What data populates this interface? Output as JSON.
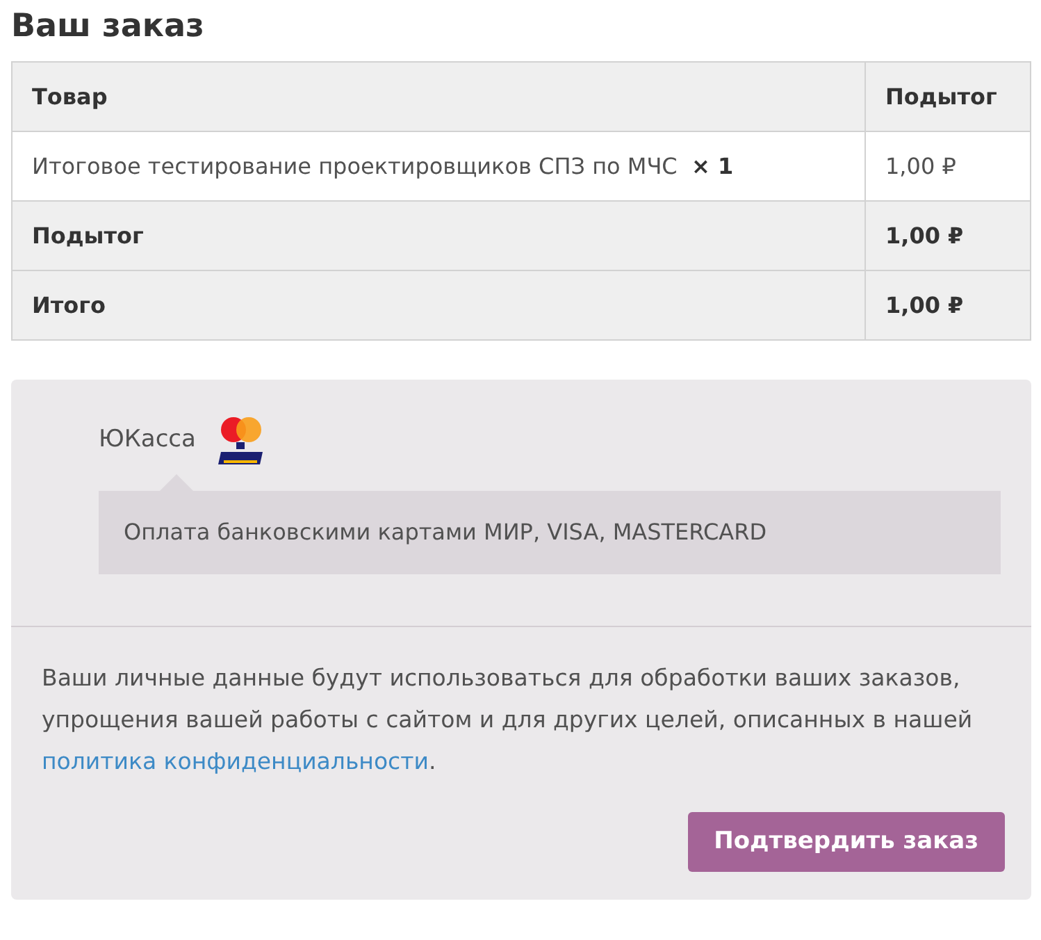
{
  "title": "Ваш заказ",
  "table": {
    "columns": [
      "Товар",
      "Подытог"
    ],
    "items": [
      {
        "name": "Итоговое тестирование проектировщиков СПЗ по МЧС",
        "quantity": "× 1",
        "subtotal": "1,00 ₽"
      }
    ],
    "totals": [
      {
        "label": "Подытог",
        "value": "1,00 ₽"
      },
      {
        "label": "Итого",
        "value": "1,00 ₽"
      }
    ]
  },
  "payment": {
    "method": "ЮКасса",
    "description": "Оплата банковскими картами МИР, VISA, MASTERCARD"
  },
  "privacy": {
    "before": "Ваши личные данные будут использоваться для обработки ваших заказов, упрощения вашей работы с сайтом и для других целей, описанных в нашей ",
    "link": "политика конфиденциальности",
    "after": "."
  },
  "submit_button": "Подтвердить заказ"
}
